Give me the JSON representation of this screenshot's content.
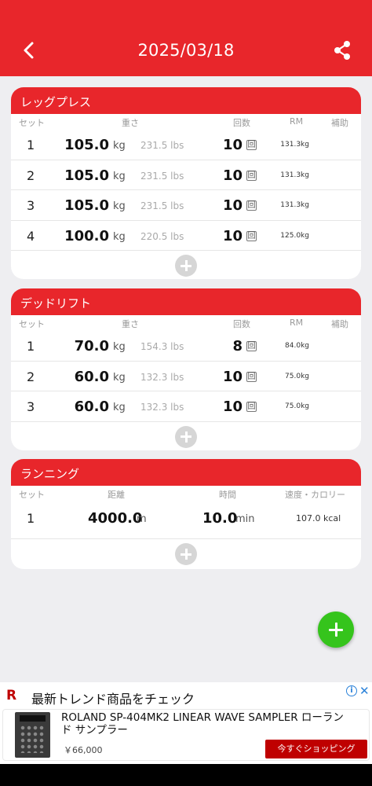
{
  "header": {
    "title": "2025/03/18",
    "back_icon": "back-arrow-icon",
    "share_icon": "share-icon"
  },
  "exercises": [
    {
      "name": "レッグプレス",
      "columns": {
        "set": "セット",
        "weight": "重さ",
        "reps": "回数",
        "rm": "RM",
        "assist": "補助"
      },
      "rows": [
        {
          "set": "1",
          "weight": "105.0",
          "kg": "kg",
          "lbs": "231.5 lbs",
          "reps": "10",
          "kai": "回",
          "rm": "131.3kg"
        },
        {
          "set": "2",
          "weight": "105.0",
          "kg": "kg",
          "lbs": "231.5 lbs",
          "reps": "10",
          "kai": "回",
          "rm": "131.3kg"
        },
        {
          "set": "3",
          "weight": "105.0",
          "kg": "kg",
          "lbs": "231.5 lbs",
          "reps": "10",
          "kai": "回",
          "rm": "131.3kg"
        },
        {
          "set": "4",
          "weight": "100.0",
          "kg": "kg",
          "lbs": "220.5 lbs",
          "reps": "10",
          "kai": "回",
          "rm": "125.0kg"
        }
      ]
    },
    {
      "name": "デッドリフト",
      "columns": {
        "set": "セット",
        "weight": "重さ",
        "reps": "回数",
        "rm": "RM",
        "assist": "補助"
      },
      "rows": [
        {
          "set": "1",
          "weight": "70.0",
          "kg": "kg",
          "lbs": "154.3 lbs",
          "reps": "8",
          "kai": "回",
          "rm": "84.0kg"
        },
        {
          "set": "2",
          "weight": "60.0",
          "kg": "kg",
          "lbs": "132.3 lbs",
          "reps": "10",
          "kai": "回",
          "rm": "75.0kg"
        },
        {
          "set": "3",
          "weight": "60.0",
          "kg": "kg",
          "lbs": "132.3 lbs",
          "reps": "10",
          "kai": "回",
          "rm": "75.0kg"
        }
      ]
    }
  ],
  "running": {
    "name": "ランニング",
    "columns": {
      "set": "セット",
      "distance": "距離",
      "time": "時間",
      "speed": "速度・カロリー"
    },
    "rows": [
      {
        "set": "1",
        "distance": "4000.0",
        "dist_unit": "m",
        "time": "10.0",
        "time_unit": "min",
        "calories": "107.0 kcal"
      }
    ]
  },
  "ad": {
    "logo": "R",
    "heading": "最新トレンド商品をチェック",
    "info": "i",
    "close": "✕",
    "product": "ROLAND SP-404MK2 LINEAR WAVE SAMPLER ローランド サンプラー",
    "price": "￥66,000",
    "cta": "今すぐショッピング"
  },
  "colors": {
    "primary": "#e8262b",
    "fab": "#35c41c",
    "background": "#eeeef1"
  }
}
